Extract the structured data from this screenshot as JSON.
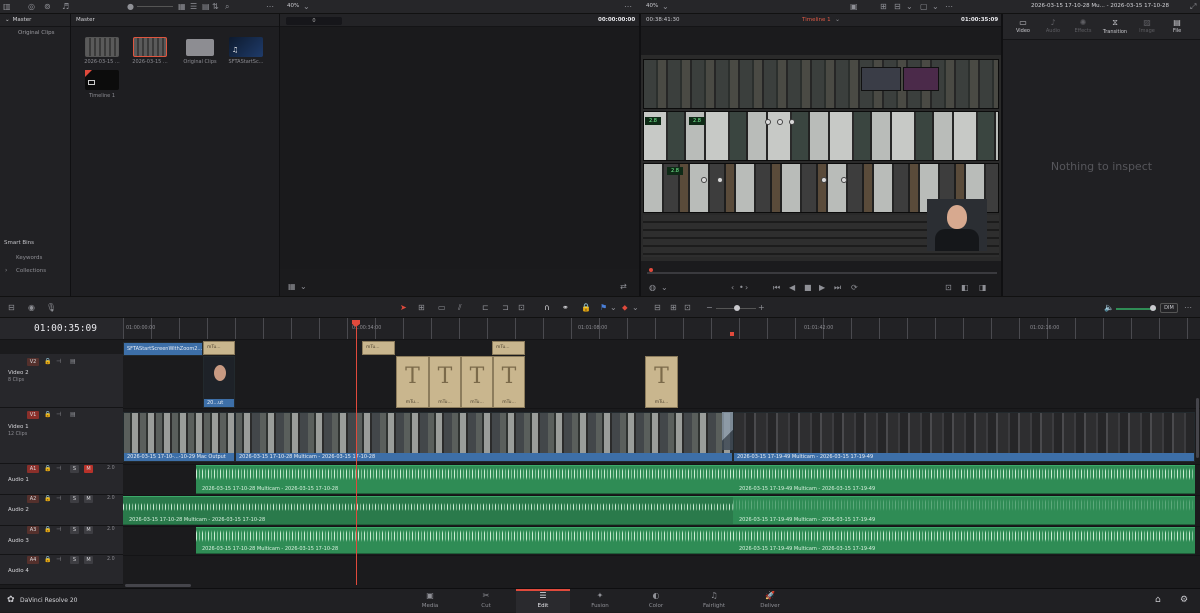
{
  "topbar": {
    "zoom_left": "40%",
    "zoom_right": "40%",
    "title": "2026-03-15 17-10-28 Mu... - 2026-03-15 17-10-28"
  },
  "media_pool": {
    "bin_tree_title": "Master",
    "bins": [
      "Original Clips"
    ],
    "smart_bins_title": "Smart Bins",
    "smart_bins": [
      "Keywords",
      "Collections"
    ],
    "grid_title": "Master",
    "clips": [
      {
        "label": "2026-03-15 ...",
        "kind": "video"
      },
      {
        "label": "2026-03-15 ...",
        "kind": "video-selected"
      },
      {
        "label": "Original Clips",
        "kind": "folder"
      },
      {
        "label": "SFTAStartSc...",
        "kind": "audio"
      },
      {
        "label": "Timeline 1",
        "kind": "timeline"
      }
    ]
  },
  "source_viewer": {
    "counter": "0",
    "timecode": "00:00:00:00"
  },
  "timeline_viewer": {
    "duration": "00:38:41:30",
    "timeline_name": "Timeline 1",
    "timecode": "01:00:35:09"
  },
  "inspector": {
    "tabs": [
      "Video",
      "Audio",
      "Effects",
      "Transition",
      "Image",
      "File"
    ],
    "empty_message": "Nothing to inspect"
  },
  "timeline": {
    "timecode": "01:00:35:09",
    "ruler": [
      "01:00:00:00",
      "01:00:34:00",
      "01:01:08:00",
      "01:01:42:00",
      "01:02:16:00"
    ],
    "tracks": [
      {
        "id": "V2",
        "name": "Video 2",
        "count": "8 Clips"
      },
      {
        "id": "V1",
        "name": "Video 1",
        "count": "12 Clips"
      },
      {
        "id": "A1",
        "name": "Audio 1",
        "level": "2.0"
      },
      {
        "id": "A2",
        "name": "Audio 2",
        "level": "2.0"
      },
      {
        "id": "A3",
        "name": "Audio 3",
        "level": "2.0"
      },
      {
        "id": "A4",
        "name": "Audio 4",
        "level": "2.0"
      }
    ],
    "v2_clips": {
      "intro": "SFTAStartScreenWithZoom2...",
      "webcam": "20...ut",
      "fusion": "mTu...",
      "title_letter": "T"
    },
    "v1_clips": {
      "a": "2026-03-15 17-10-...-10-29 Mac Output",
      "b": "2026-03-15 17-10-28 Multicam - 2026-03-15 17-10-28",
      "c": "2026-03-15 17-19-49 Multicam - 2026-03-15 17-19-49"
    },
    "audio_clips": {
      "first": "2026-03-15 17-10-28 Multicam - 2026-03-15 17-10-28",
      "second": "2026-03-15 17-19-49 Multicam - 2026-03-15 17-19-49"
    },
    "mute_label": "M",
    "solo_label": "S",
    "dim_label": "DIM"
  },
  "pages": {
    "app_name": "DaVinci Resolve 20",
    "items": [
      {
        "label": "Media",
        "icon": "media-icon"
      },
      {
        "label": "Cut",
        "icon": "cut-icon"
      },
      {
        "label": "Edit",
        "icon": "edit-icon"
      },
      {
        "label": "Fusion",
        "icon": "fusion-icon"
      },
      {
        "label": "Color",
        "icon": "color-icon"
      },
      {
        "label": "Fairlight",
        "icon": "fairlight-icon"
      },
      {
        "label": "Deliver",
        "icon": "deliver-icon"
      }
    ],
    "active": "Edit"
  },
  "colors": {
    "accent_red": "#e04a3c",
    "video_clip_blue": "#3d6fa8",
    "audio_clip_green": "#2f8c55",
    "title_clip_tan": "#c9b68e"
  }
}
